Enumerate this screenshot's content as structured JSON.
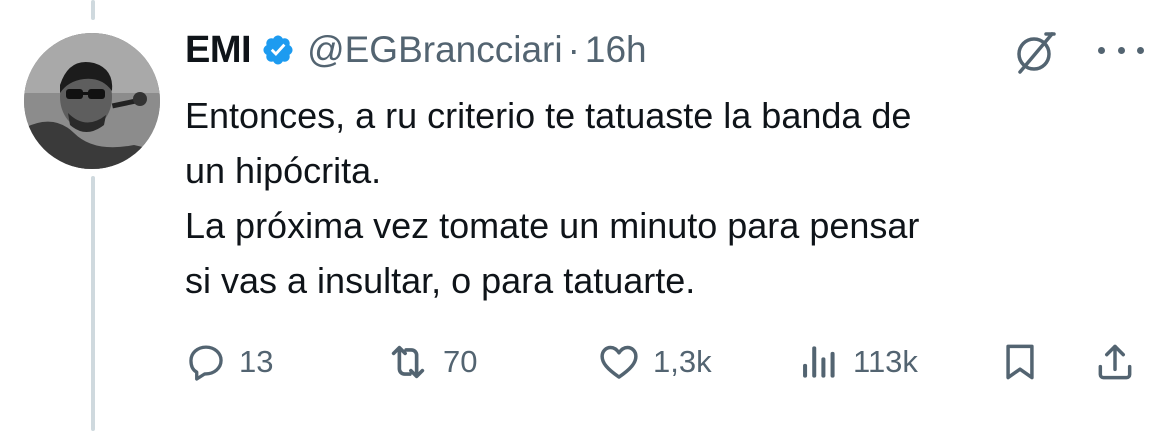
{
  "author": {
    "name": "EMI",
    "handle": "@EGBrancciari",
    "separator": "·",
    "time": "16h"
  },
  "tweet": {
    "lines": [
      "Entonces, a ru criterio te tatuaste la banda de",
      "un hipócrita.",
      "La próxima vez tomate un minuto para pensar",
      "si vas a insultar, o para tatuarte."
    ]
  },
  "actions": {
    "replies": "13",
    "reposts": "70",
    "likes": "1,3k",
    "views": "113k"
  },
  "colors": {
    "text": "#0f1419",
    "secondary": "#536471",
    "verified": "#1d9bf0",
    "thread_line": "#cfd9de"
  },
  "icons": [
    "verified-badge-icon",
    "grok-icon",
    "more-icon",
    "reply-icon",
    "repost-icon",
    "like-icon",
    "views-icon",
    "bookmark-icon",
    "share-icon"
  ]
}
